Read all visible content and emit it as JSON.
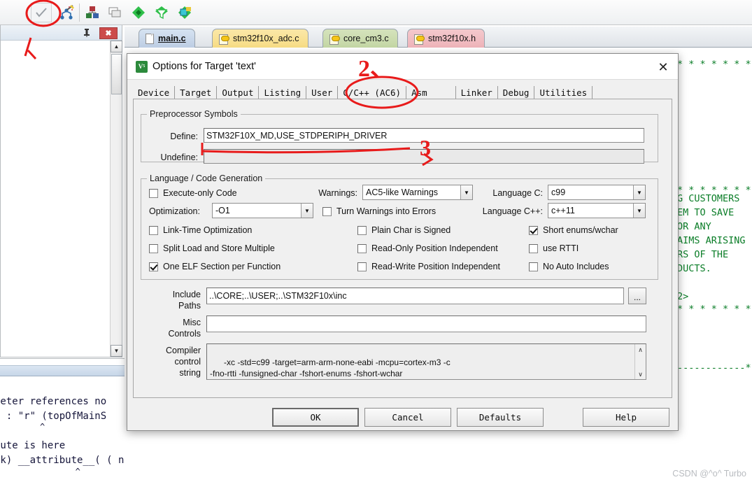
{
  "toolbar": {
    "icons": [
      {
        "name": "check-icon",
        "glyph": "✓"
      },
      {
        "name": "build-target-icon",
        "glyph": "⚒"
      },
      {
        "name": "manage-project-items-icon",
        "glyph": "■"
      },
      {
        "name": "windows-icon",
        "glyph": "❐"
      },
      {
        "name": "configuration-wizard-icon",
        "glyph": "◆"
      },
      {
        "name": "filter-icon",
        "glyph": "▼"
      },
      {
        "name": "pack-installer-icon",
        "glyph": "▣"
      }
    ]
  },
  "project_panel": {
    "pin_glyph": "📌",
    "close_label": "✖"
  },
  "editor_tabs": [
    {
      "label": "main.c",
      "color": "active",
      "icon": "document-icon"
    },
    {
      "label": "stm32f10x_adc.c",
      "color": "yellow",
      "icon": "key-document-icon"
    },
    {
      "label": "core_cm3.c",
      "color": "green",
      "icon": "key-document-icon"
    },
    {
      "label": "stm32f10x.h",
      "color": "pink",
      "icon": "key-document-icon"
    }
  ],
  "code_background": {
    "right_lines": [
      "* * * * * * * * * * * * * * * * * * * * *",
      "",
      "",
      "",
      "",
      "",
      "",
      "",
      "* * * * * * * * * * * * * * * * * * * * *",
      "",
      "",
      "",
      "",
      "",
      "",
      "",
      "",
      "G CUSTOMERS",
      "EM TO SAVE",
      "OR ANY",
      "AIMS ARISING",
      "RS OF THE",
      "DUCTS.",
      "",
      "2>",
      "* * * * * * * * * * * * * * * * * * * * *",
      "",
      "",
      "",
      "",
      "------------*"
    ],
    "left_lines": [
      "meter references no",
      ": : \"r\" (topOfMainS",
      "         ^",
      "bute is here",
      "ck) __attribute__( ( naked ) );",
      "                ^"
    ]
  },
  "dialog": {
    "title": "Options for Target 'text'",
    "icon": "keil-uvision-icon",
    "close_label": "✕",
    "tabs": [
      {
        "label": "Device",
        "selected": false
      },
      {
        "label": "Target",
        "selected": false
      },
      {
        "label": "Output",
        "selected": false
      },
      {
        "label": "Listing",
        "selected": false
      },
      {
        "label": "User",
        "selected": false
      },
      {
        "label": "C/C++ (AC6)",
        "selected": true
      },
      {
        "label": "Asm",
        "selected": false
      },
      {
        "label": "Linker",
        "selected": false
      },
      {
        "label": "Debug",
        "selected": false
      },
      {
        "label": "Utilities",
        "selected": false
      }
    ],
    "preprocessor": {
      "legend": "Preprocessor Symbols",
      "define_label": "Define:",
      "define_value": "STM32F10X_MD,USE_STDPERIPH_DRIVER",
      "undefine_label": "Undefine:",
      "undefine_value": ""
    },
    "language": {
      "legend": "Language / Code Generation",
      "execute_only_label": "Execute-only Code",
      "execute_only_checked": false,
      "optimization_label": "Optimization:",
      "optimization_value": "-O1",
      "link_time_opt_label": "Link-Time Optimization",
      "link_time_opt_checked": false,
      "split_load_label": "Split Load and Store Multiple",
      "split_load_checked": false,
      "one_elf_label": "One ELF Section per Function",
      "one_elf_checked": true,
      "warnings_label": "Warnings:",
      "warnings_value": "AC5-like Warnings",
      "warnings_errors_label": "Turn Warnings into Errors",
      "warnings_errors_checked": false,
      "plain_char_label": "Plain Char is Signed",
      "plain_char_checked": false,
      "ro_pos_indep_label": "Read-Only Position Independent",
      "ro_pos_indep_checked": false,
      "rw_pos_indep_label": "Read-Write Position Independent",
      "rw_pos_indep_checked": false,
      "language_c_label": "Language C:",
      "language_c_value": "c99",
      "language_cpp_label": "Language C++:",
      "language_cpp_value": "c++11",
      "short_enums_label": "Short enums/wchar",
      "short_enums_checked": true,
      "use_rtti_label": "use RTTI",
      "use_rtti_checked": false,
      "no_auto_includes_label": "No Auto Includes",
      "no_auto_includes_checked": false
    },
    "paths": {
      "include_label_1": "Include",
      "include_label_2": "Paths",
      "include_value": "..\\CORE;..\\USER;..\\STM32F10x\\inc",
      "browse_label": "...",
      "misc_label_1": "Misc",
      "misc_label_2": "Controls",
      "misc_value": "",
      "compiler_label_1": "Compiler",
      "compiler_label_2": "control",
      "compiler_label_3": "string",
      "compiler_value": "-xc -std=c99 -target=arm-arm-none-eabi -mcpu=cortex-m3 -c\n-fno-rtti -funsigned-char -fshort-enums -fshort-wchar",
      "scroll_up": "∧",
      "scroll_down": "∨"
    },
    "buttons": [
      {
        "label": "OK",
        "default": true
      },
      {
        "label": "Cancel",
        "default": false
      },
      {
        "label": "Defaults",
        "default": false
      },
      {
        "label": "Help",
        "default": false
      }
    ]
  },
  "annotations": {
    "step1": "",
    "step2": "2、",
    "step3": "3"
  },
  "watermark": "CSDN @^o^ Turbo",
  "colors": {
    "annotation_red": "#e81b1b",
    "code_green": "#0a7d27",
    "dialog_bg": "#f0f0f0",
    "tab_active_blue": "#c7d6e8"
  }
}
